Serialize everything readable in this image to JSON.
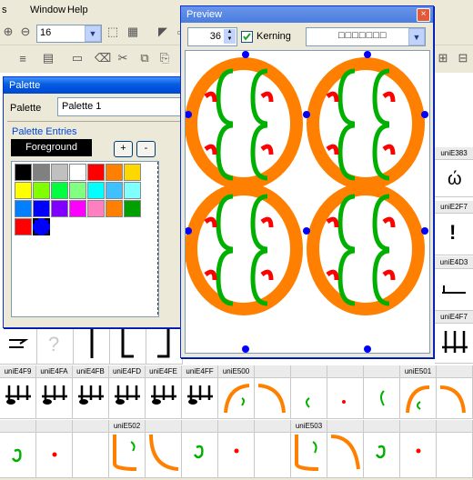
{
  "menu": [
    "Window",
    "Help"
  ],
  "toolbar": {
    "size_value": "16"
  },
  "palette_window": {
    "title": "Palette",
    "palette_label": "Palette",
    "palette_value": "Palette 1",
    "entries_label": "Palette Entries",
    "foreground_label": "Foreground",
    "add_label": "+",
    "remove_label": "-",
    "colors": [
      "#000000",
      "#808080",
      "#c0c0c0",
      "#ffffff",
      "#ff0000",
      "#ff8000",
      "#ffd700",
      "#ffff00",
      "#80ff00",
      "#00ff40",
      "#80ff80",
      "#00ffff",
      "#40c0ff",
      "#80ffff",
      "#0080ff",
      "#0000ff",
      "#8000ff",
      "#ff00ff",
      "#ff80c0",
      "#ff8000",
      "#00a000",
      "#ff0000",
      "#0000ff"
    ]
  },
  "preview_window": {
    "title": "Preview",
    "size_value": "36",
    "kerning_label": "Kerning",
    "glyph_string": "□□□□□□□"
  },
  "glyph_grid": {
    "right_labels": [
      "uniE383",
      "uniE2F7",
      "uniE4D3",
      "uniE4F7"
    ],
    "row1_labels": [
      "uniE4F9",
      "uniE4FA",
      "uniE4FB",
      "uniE4FD",
      "uniE4FE",
      "uniE4FF",
      "uniE500",
      "",
      "",
      "",
      "",
      "uniE501",
      ""
    ],
    "row2_labels": [
      "",
      "",
      "",
      "uniE502",
      "",
      "",
      "",
      "",
      "uniE503",
      "",
      "",
      "",
      ""
    ]
  },
  "colors": {
    "orange": "#ff8000",
    "green": "#00b000",
    "red": "#ff0000",
    "blue": "#0000ff"
  }
}
